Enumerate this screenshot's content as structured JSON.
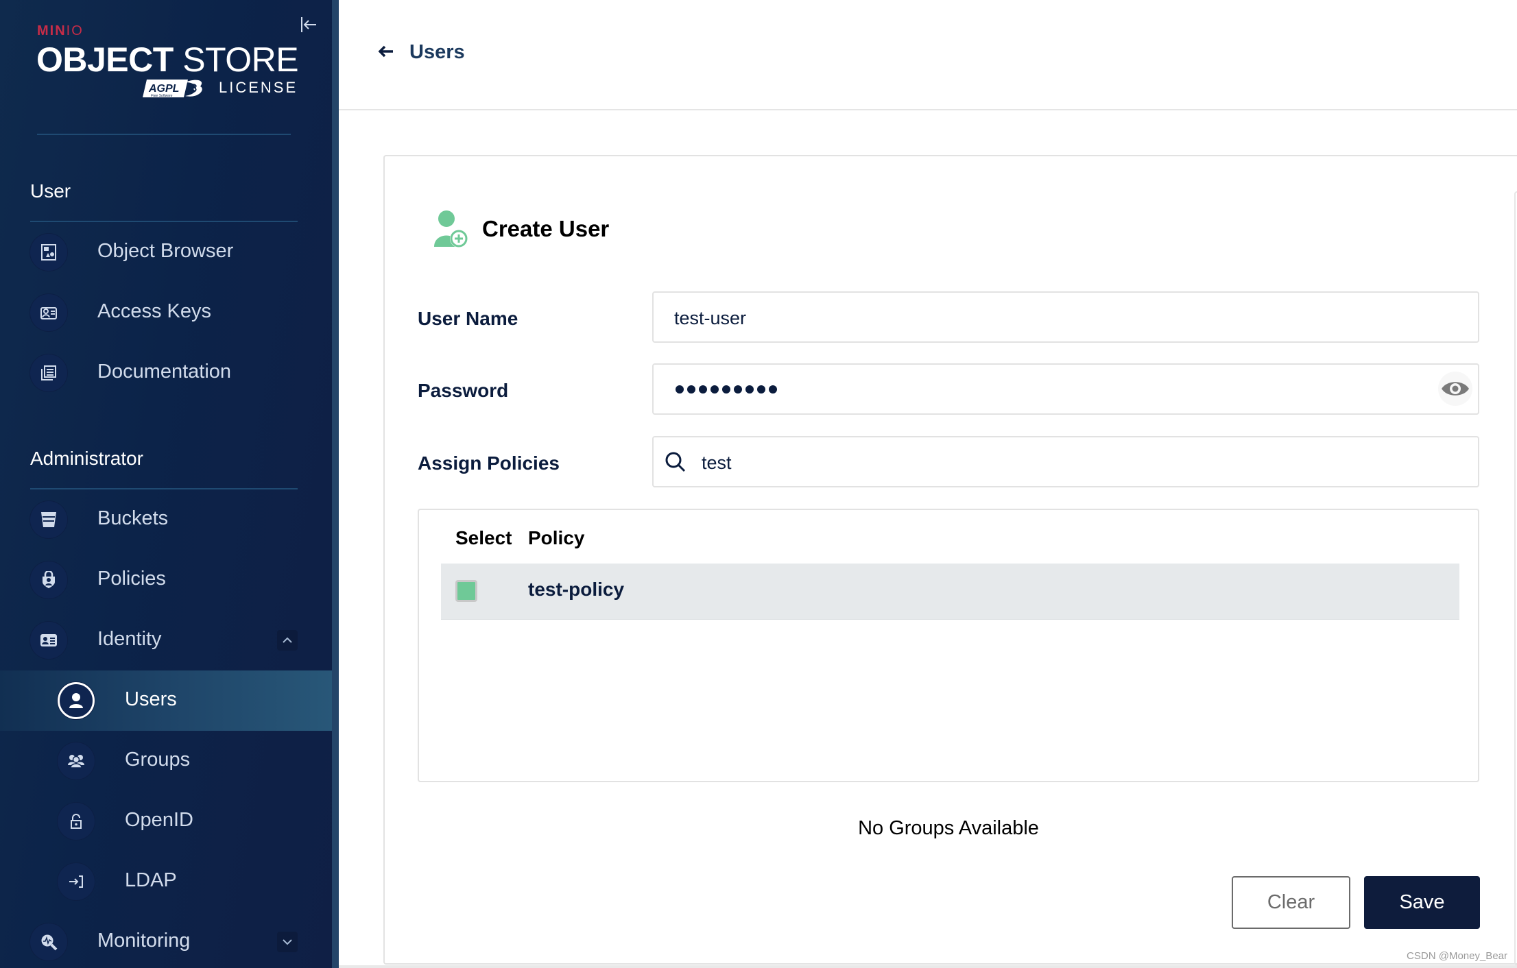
{
  "sidebar": {
    "logo": {
      "brand_bold": "MIN",
      "brand_thin": "IO",
      "product_bold": "OBJECT",
      "product_light": "STORE",
      "badge": "AGPL",
      "badge_sub": "Free Software",
      "license": "LICENSE"
    },
    "collapse_icon": "collapse-left-icon",
    "sections": [
      {
        "title": "User",
        "items": [
          {
            "label": "Object Browser",
            "icon": "object-browser-icon"
          },
          {
            "label": "Access Keys",
            "icon": "access-keys-icon"
          },
          {
            "label": "Documentation",
            "icon": "documentation-icon"
          }
        ]
      },
      {
        "title": "Administrator",
        "items": [
          {
            "label": "Buckets",
            "icon": "bucket-icon"
          },
          {
            "label": "Policies",
            "icon": "policy-shield-icon"
          },
          {
            "label": "Identity",
            "icon": "identity-card-icon",
            "expanded": true,
            "children": [
              {
                "label": "Users",
                "icon": "user-icon",
                "selected": true
              },
              {
                "label": "Groups",
                "icon": "groups-icon"
              },
              {
                "label": "OpenID",
                "icon": "lock-icon"
              },
              {
                "label": "LDAP",
                "icon": "login-icon"
              }
            ]
          },
          {
            "label": "Monitoring",
            "icon": "monitoring-icon",
            "expanded": false
          }
        ]
      }
    ]
  },
  "header": {
    "back_label": "Users",
    "back_icon": "arrow-left-icon"
  },
  "form": {
    "title": "Create User",
    "title_icon": "add-user-icon",
    "fields": {
      "username": {
        "label": "User Name",
        "value": "test-user"
      },
      "password": {
        "label": "Password",
        "masked_length": 9,
        "toggle_icon": "eye-icon"
      },
      "policies": {
        "label": "Assign Policies",
        "search_value": "test",
        "search_icon": "search-icon"
      }
    },
    "policy_table": {
      "columns": [
        "Select",
        "Policy"
      ],
      "rows": [
        {
          "policy": "test-policy",
          "selected": true
        }
      ]
    },
    "groups_empty_text": "No Groups Available",
    "buttons": {
      "clear": "Clear",
      "save": "Save"
    }
  },
  "colors": {
    "sidebar_bg": "#0c2349",
    "accent_green": "#6fc997",
    "primary_button": "#0e1c3c",
    "brand_red": "#c72c48",
    "header_text": "#1c3a5e"
  },
  "watermark": "CSDN @Money_Bear"
}
